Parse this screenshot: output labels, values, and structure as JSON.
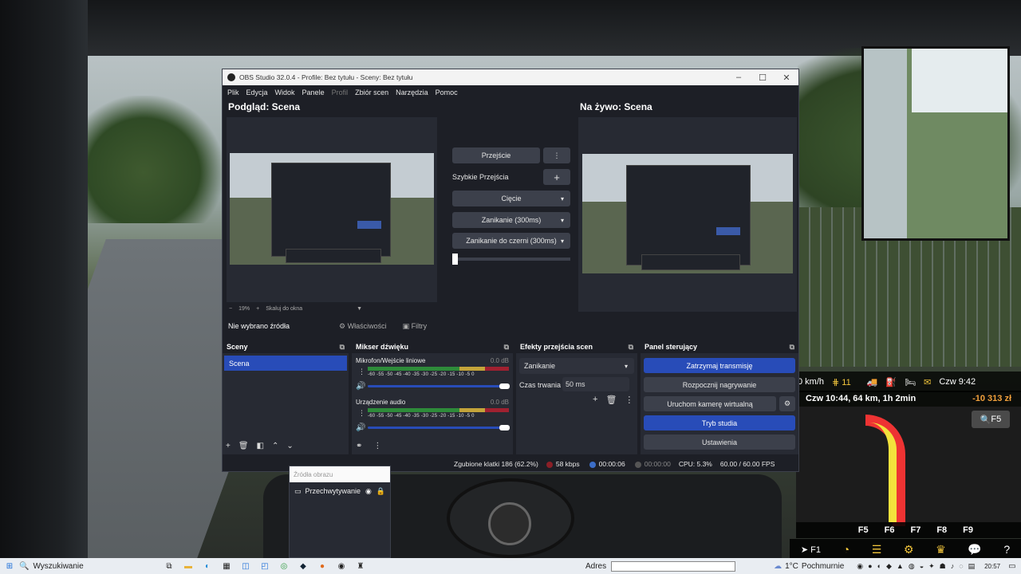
{
  "obs": {
    "title": "OBS Studio 32.0.4 - Profile: Bez tytułu - Sceny: Bez tytułu",
    "menu": [
      "Plik",
      "Edycja",
      "Widok",
      "Panele",
      "Profil",
      "Zbiór scen",
      "Narzędzia",
      "Pomoc"
    ],
    "preview_title": "Podgląd: Scena",
    "live_title": "Na żywo: Scena",
    "zoom_minus": "−",
    "zoom_value": "19%",
    "zoom_plus": "+",
    "zoom_mode": "Skaluj do okna",
    "transition": {
      "button": "Przejście",
      "quick_label": "Szybkie Przejścia",
      "items": [
        "Cięcie",
        "Zanikanie (300ms)",
        "Zanikanie do czerni (300ms)"
      ]
    },
    "source_bar": {
      "no_source": "Nie wybrano źródła",
      "properties": "Właściwości",
      "filters": "Filtry"
    },
    "scenes": {
      "title": "Sceny",
      "items": [
        "Scena"
      ]
    },
    "mixer": {
      "title": "Mikser dźwięku",
      "tracks": [
        {
          "name": "Mikrofon/Wejście liniowe",
          "db": "0.0 dB"
        },
        {
          "name": "Urządzenie audio",
          "db": "0.0 dB"
        }
      ],
      "ticks": "-60 -55 -50 -45 -40 -35 -30 -25 -20 -15 -10 -5 0"
    },
    "effects": {
      "title": "Efekty przejścia scen",
      "selected": "Zanikanie",
      "duration_label": "Czas trwania",
      "duration_value": "50 ms"
    },
    "controls": {
      "title": "Panel sterujący",
      "stop_stream": "Zatrzymaj transmisję",
      "start_record": "Rozpocznij nagrywanie",
      "virtual_cam": "Uruchom kamerę wirtualną",
      "studio_mode": "Tryb studia",
      "settings": "Ustawienia"
    },
    "status": {
      "dropped": "Zgubione klatki 186 (62.2%)",
      "bitrate": "58 kbps",
      "stream_time": "00:00:06",
      "rec_time": "00:00:00",
      "cpu": "CPU: 5.3%",
      "fps": "60.00 / 60.00 FPS"
    }
  },
  "popup": {
    "header": "Źródła obrazu",
    "item": "Przechwytywanie"
  },
  "hud": {
    "speed": "0 km/h",
    "counter": "11",
    "clock": "Czw 9:42",
    "route": "Czw 10:44, 64 km, 1h 2min",
    "money": "-10 313 zł",
    "search_key": "F5",
    "fkeys": [
      "F5",
      "F6",
      "F7",
      "F8",
      "F9"
    ],
    "f1": "F1"
  },
  "taskbar": {
    "search": "Wyszukiwanie",
    "address_label": "Adres",
    "weather": "1°C",
    "weather_text": "Pochmurnie",
    "time": "20:57"
  },
  "colors": {
    "accent": "#284cb8",
    "panel": "#272a33",
    "window": "#1d1f26",
    "money": "#f1a03c"
  }
}
